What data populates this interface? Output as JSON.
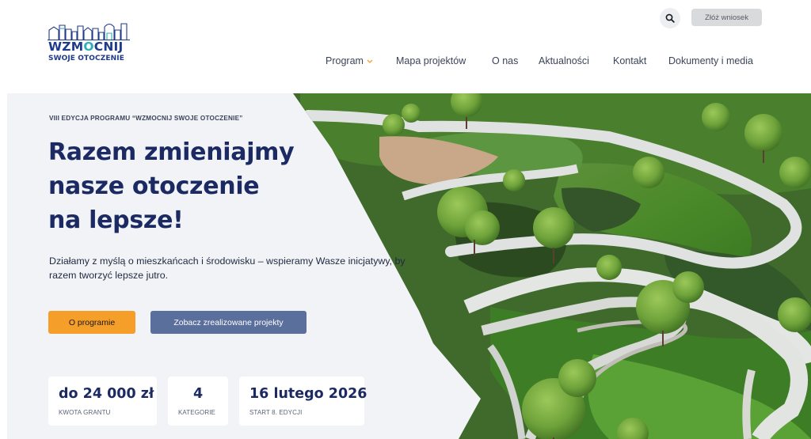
{
  "logo": {
    "part1": "WZM",
    "accent": "O",
    "part2": "CNIJ",
    "line2": "SWOJE OTOCZENIE"
  },
  "header": {
    "search_icon": "search-icon",
    "apply_label": "Złóż wniosek"
  },
  "nav": {
    "items": [
      {
        "label": "Program"
      },
      {
        "label": "Mapa projektów"
      },
      {
        "label": "O nas"
      },
      {
        "label": "Aktualności"
      },
      {
        "label": "Kontakt"
      },
      {
        "label": "Dokumenty i media"
      }
    ]
  },
  "hero": {
    "edition": "VIII EDYCJA PROGRAMU “WZMOCNIJ SWOJE OTOCZENIE”",
    "headline": [
      "Razem zmieniajmy",
      "nasze otoczenie",
      "na lepsze!"
    ],
    "subtext": "Działamy z myślą o mieszkańcach i środowisku – wspieramy Wasze inicjatywy, by razem tworzyć lepsze jutro.",
    "primary_button": "O programie",
    "secondary_button": "Zobacz zrealizowane projekty",
    "stats": [
      {
        "value": "do 24 000 zł",
        "label": "KWOTA GRANTU"
      },
      {
        "value": "4",
        "label": "KATEGORIE"
      },
      {
        "value": "16 lutego 2026",
        "label": "START 8. EDYCJI"
      }
    ]
  },
  "colors": {
    "brand_navy": "#1b2a63",
    "accent_teal": "#2cb1b5",
    "orange": "#f59e2a",
    "slate_button": "#5a6f9c"
  }
}
